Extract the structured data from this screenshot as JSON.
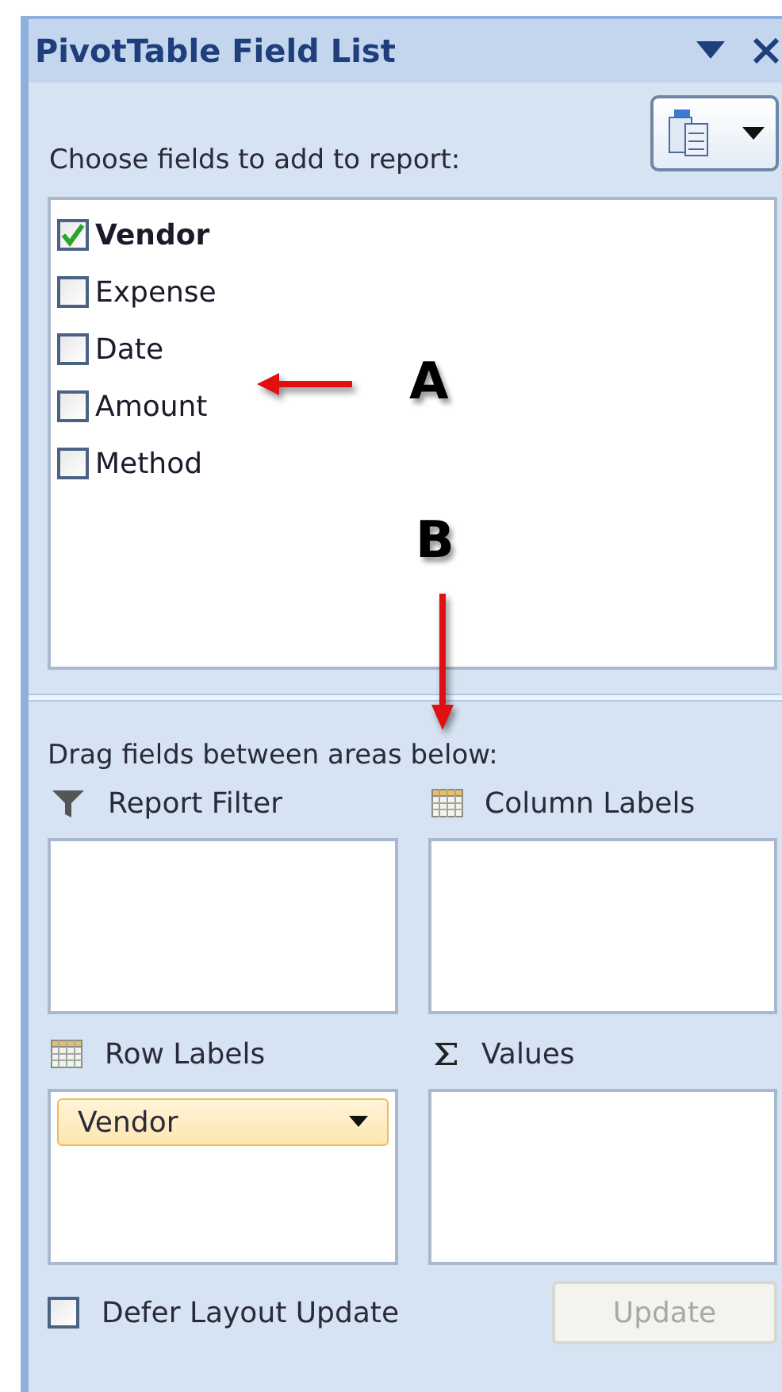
{
  "window": {
    "title": "PivotTable Field List"
  },
  "choose_label": "Choose fields to add to report:",
  "fields": [
    {
      "label": "Vendor",
      "checked": true
    },
    {
      "label": "Expense",
      "checked": false
    },
    {
      "label": "Date",
      "checked": false
    },
    {
      "label": "Amount",
      "checked": false
    },
    {
      "label": "Method",
      "checked": false
    }
  ],
  "drag_label": "Drag fields between areas below:",
  "areas": [
    {
      "kind": "filter",
      "label": "Report Filter"
    },
    {
      "kind": "columns",
      "label": "Column Labels"
    },
    {
      "kind": "rows",
      "label": "Row Labels",
      "items": [
        "Vendor"
      ]
    },
    {
      "kind": "values",
      "label": "Values"
    }
  ],
  "defer": {
    "label": "Defer Layout Update",
    "checked": false
  },
  "update_button": {
    "label": "Update",
    "disabled": true
  },
  "annotations": [
    {
      "label": "A",
      "kind": "left"
    },
    {
      "label": "B",
      "kind": "down"
    }
  ]
}
